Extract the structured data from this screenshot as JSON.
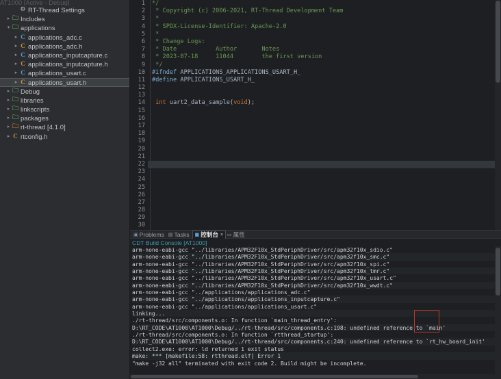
{
  "sidebar": {
    "name": "project-explorer",
    "clipped_top_row": "AT1000  [Active - Debug]",
    "items": [
      {
        "label": "RT-Thread Settings",
        "icon": "gear-icon",
        "indent": 1,
        "twisty": "",
        "kind": "settings"
      },
      {
        "label": "Includes",
        "icon": "folder-icon",
        "indent": 0,
        "twisty": "▸",
        "kind": "folder"
      },
      {
        "label": "applications",
        "icon": "folder-open-icon",
        "indent": 0,
        "twisty": "▾",
        "kind": "folder"
      },
      {
        "label": "applications_adc.c",
        "icon": "c-source-icon",
        "indent": 1,
        "twisty": "▸",
        "kind": "c"
      },
      {
        "label": "applications_adc.h",
        "icon": "c-header-icon",
        "indent": 1,
        "twisty": "▸",
        "kind": "h"
      },
      {
        "label": "applications_inputcapture.c",
        "icon": "c-source-icon",
        "indent": 1,
        "twisty": "▸",
        "kind": "c"
      },
      {
        "label": "applications_inputcapture.h",
        "icon": "c-header-icon",
        "indent": 1,
        "twisty": "▸",
        "kind": "h"
      },
      {
        "label": "applications_usart.c",
        "icon": "c-source-icon",
        "indent": 1,
        "twisty": "▸",
        "kind": "c"
      },
      {
        "label": "applications_usart.h",
        "icon": "c-header-icon",
        "indent": 1,
        "twisty": "▸",
        "kind": "h",
        "selected": true
      },
      {
        "label": "Debug",
        "icon": "folder-icon",
        "indent": 0,
        "twisty": "▸",
        "kind": "folder"
      },
      {
        "label": "libraries",
        "icon": "folder-icon",
        "indent": 0,
        "twisty": "▸",
        "kind": "folder"
      },
      {
        "label": "linkscripts",
        "icon": "folder-icon",
        "indent": 0,
        "twisty": "▸",
        "kind": "folder"
      },
      {
        "label": "packages",
        "icon": "folder-icon",
        "indent": 0,
        "twisty": "▸",
        "kind": "folder"
      },
      {
        "label": "rt-thread [4.1.0]",
        "icon": "rt-thread-icon",
        "indent": 0,
        "twisty": "▸",
        "kind": "rtt"
      },
      {
        "label": "rtconfig.h",
        "icon": "c-header-icon",
        "indent": 0,
        "twisty": "▸",
        "kind": "h"
      }
    ]
  },
  "editor": {
    "name": "code-editor",
    "cursor_line": 22,
    "first_visible_line": 1,
    "lines": [
      {
        "n": 1,
        "text": "*/",
        "cls": "c-comment",
        "clipped": true
      },
      {
        "n": 2,
        "text": " * Copyright (c) 2006-2021, RT-Thread Development Team",
        "cls": "c-comment"
      },
      {
        "n": 3,
        "text": " *",
        "cls": "c-comment"
      },
      {
        "n": 4,
        "text": " * SPDX-License-Identifier: Apache-2.0",
        "cls": "c-comment"
      },
      {
        "n": 5,
        "text": " *",
        "cls": "c-comment"
      },
      {
        "n": 6,
        "text": " * Change Logs:",
        "cls": "c-comment"
      },
      {
        "n": 7,
        "text": " * Date           Author       Notes",
        "cls": "c-comment"
      },
      {
        "n": 8,
        "text": " * 2023-07-18     11044        the first version",
        "cls": "c-comment"
      },
      {
        "n": 9,
        "text": " */",
        "cls": "c-comment"
      },
      {
        "n": 10,
        "text": "#ifndef APPLICATIONS_APPLICATIONS_USART_H_",
        "cls": "c-pp"
      },
      {
        "n": 11,
        "text": "#define APPLICATIONS_USART_H_",
        "cls": "c-pp"
      },
      {
        "n": 12,
        "text": "",
        "cls": "c-plain"
      },
      {
        "n": 13,
        "text": "",
        "cls": "c-plain"
      },
      {
        "n": 14,
        "text": " int uart2_data_sample(void);",
        "cls": "c-code"
      },
      {
        "n": 15,
        "text": "",
        "cls": "c-plain"
      },
      {
        "n": 16,
        "text": "",
        "cls": "c-plain"
      },
      {
        "n": 17,
        "text": "",
        "cls": "c-plain"
      },
      {
        "n": 18,
        "text": "",
        "cls": "c-plain"
      },
      {
        "n": 19,
        "text": "",
        "cls": "c-plain"
      },
      {
        "n": 20,
        "text": "",
        "cls": "c-plain"
      },
      {
        "n": 21,
        "text": "",
        "cls": "c-plain"
      },
      {
        "n": 22,
        "text": "",
        "cls": "c-plain"
      },
      {
        "n": 23,
        "text": "",
        "cls": "c-plain"
      },
      {
        "n": 24,
        "text": "",
        "cls": "c-plain"
      },
      {
        "n": 25,
        "text": "",
        "cls": "c-plain"
      },
      {
        "n": 26,
        "text": "",
        "cls": "c-plain"
      },
      {
        "n": 27,
        "text": "",
        "cls": "c-plain"
      },
      {
        "n": 28,
        "text": "",
        "cls": "c-plain"
      },
      {
        "n": 29,
        "text": "",
        "cls": "c-plain"
      },
      {
        "n": 30,
        "text": "",
        "cls": "c-plain"
      }
    ]
  },
  "panel": {
    "tabs": [
      {
        "label": "Problems",
        "icon": "problems-icon",
        "active": false
      },
      {
        "label": "Tasks",
        "icon": "tasks-icon",
        "active": false
      },
      {
        "label": "控制台",
        "icon": "console-icon",
        "active": true,
        "close": "×"
      },
      {
        "label": "属性",
        "icon": "properties-icon",
        "active": false
      }
    ],
    "console_title": "CDT Build Console [AT1000]",
    "lines": [
      "arm-none-eabi-gcc \"../libraries/APM32F10x_StdPeriphDriver/src/apm32f10x_sdio.c\"",
      "arm-none-eabi-gcc \"../libraries/APM32F10x_StdPeriphDriver/src/apm32f10x_smc.c\"",
      "arm-none-eabi-gcc \"../libraries/APM32F10x_StdPeriphDriver/src/apm32f10x_spi.c\"",
      "arm-none-eabi-gcc \"../libraries/APM32F10x_StdPeriphDriver/src/apm32f10x_tmr.c\"",
      "arm-none-eabi-gcc \"../libraries/APM32F10x_StdPeriphDriver/src/apm32f10x_usart.c\"",
      "arm-none-eabi-gcc \"../libraries/APM32F10x_StdPeriphDriver/src/apm32f10x_wwdt.c\"",
      "arm-none-eabi-gcc \"../applications/applications_adc.c\"",
      "arm-none-eabi-gcc \"../applications/applications_inputcapture.c\"",
      "arm-none-eabi-gcc \"../applications/applications_usart.c\"",
      "linking...",
      "./rt-thread/src/components.o: In function `main_thread_entry':",
      "D:\\RT_CODE\\AT1000\\AT1000\\Debug/../rt-thread/src/components.c:198: undefined reference to `main'",
      "./rt-thread/src/components.o: In function `rtthread_startup':",
      "D:\\RT_CODE\\AT1000\\AT1000\\Debug/../rt-thread/src/components.c:240: undefined reference to `rt_hw_board_init'",
      "collect2.exe: error: ld returned 1 exit status",
      "make: *** [makefile:58: rtthread.elf] Error 1",
      "\"make -j32 all\" terminated with exit code 2. Build might be incomplete."
    ]
  },
  "annotation": {
    "name": "red-highlight-box",
    "target_text": "`main'",
    "color": "#c0392b"
  },
  "colors": {
    "editor_bg": "#1e1f22",
    "sidebar_bg": "#2b2d30",
    "comment_green": "#6a9955",
    "preprocessor_blue": "#7fb3d5",
    "keyword_orange": "#cc7832",
    "console_title_teal": "#3d9aa8",
    "selection_gray": "#3c4043",
    "annotation_red": "#c0392b"
  }
}
